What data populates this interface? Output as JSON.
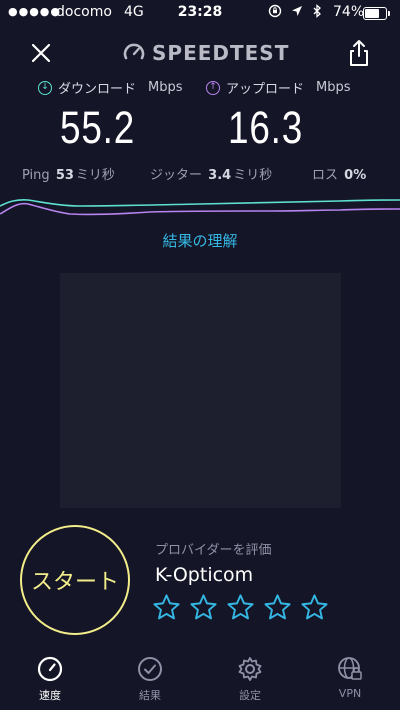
{
  "status_bar": {
    "signal": "●●●●●",
    "carrier": "docomo",
    "network": "4G",
    "time": "23:28",
    "battery_percent": "74%",
    "battery_level": 0.74
  },
  "header": {
    "brand": "SPEEDTEST",
    "close_icon": "close-icon",
    "share_icon": "share-icon"
  },
  "download": {
    "label": "ダウンロード",
    "unit": "Mbps",
    "value": "55.2",
    "color": "#5ee1d0"
  },
  "upload": {
    "label": "アップロード",
    "unit": "Mbps",
    "value": "16.3",
    "color": "#b784f0"
  },
  "stats": {
    "ping_label": "Ping",
    "ping_value": "53",
    "ping_unit": "ミリ秒",
    "jitter_label": "ジッター",
    "jitter_value": "3.4",
    "jitter_unit": "ミリ秒",
    "loss_label": "ロス",
    "loss_value": "0%"
  },
  "results_link": "結果の理解",
  "start_button": "スタート",
  "rating": {
    "label": "プロバイダーを評価",
    "provider": "K-Opticom",
    "star_count": 5,
    "star_color": "#35b7e4"
  },
  "tabs": [
    {
      "label": "速度",
      "icon": "speedometer-icon",
      "active": true
    },
    {
      "label": "結果",
      "icon": "check-circle-icon",
      "active": false
    },
    {
      "label": "設定",
      "icon": "gear-icon",
      "active": false
    },
    {
      "label": "VPN",
      "icon": "globe-lock-icon",
      "active": false
    }
  ]
}
